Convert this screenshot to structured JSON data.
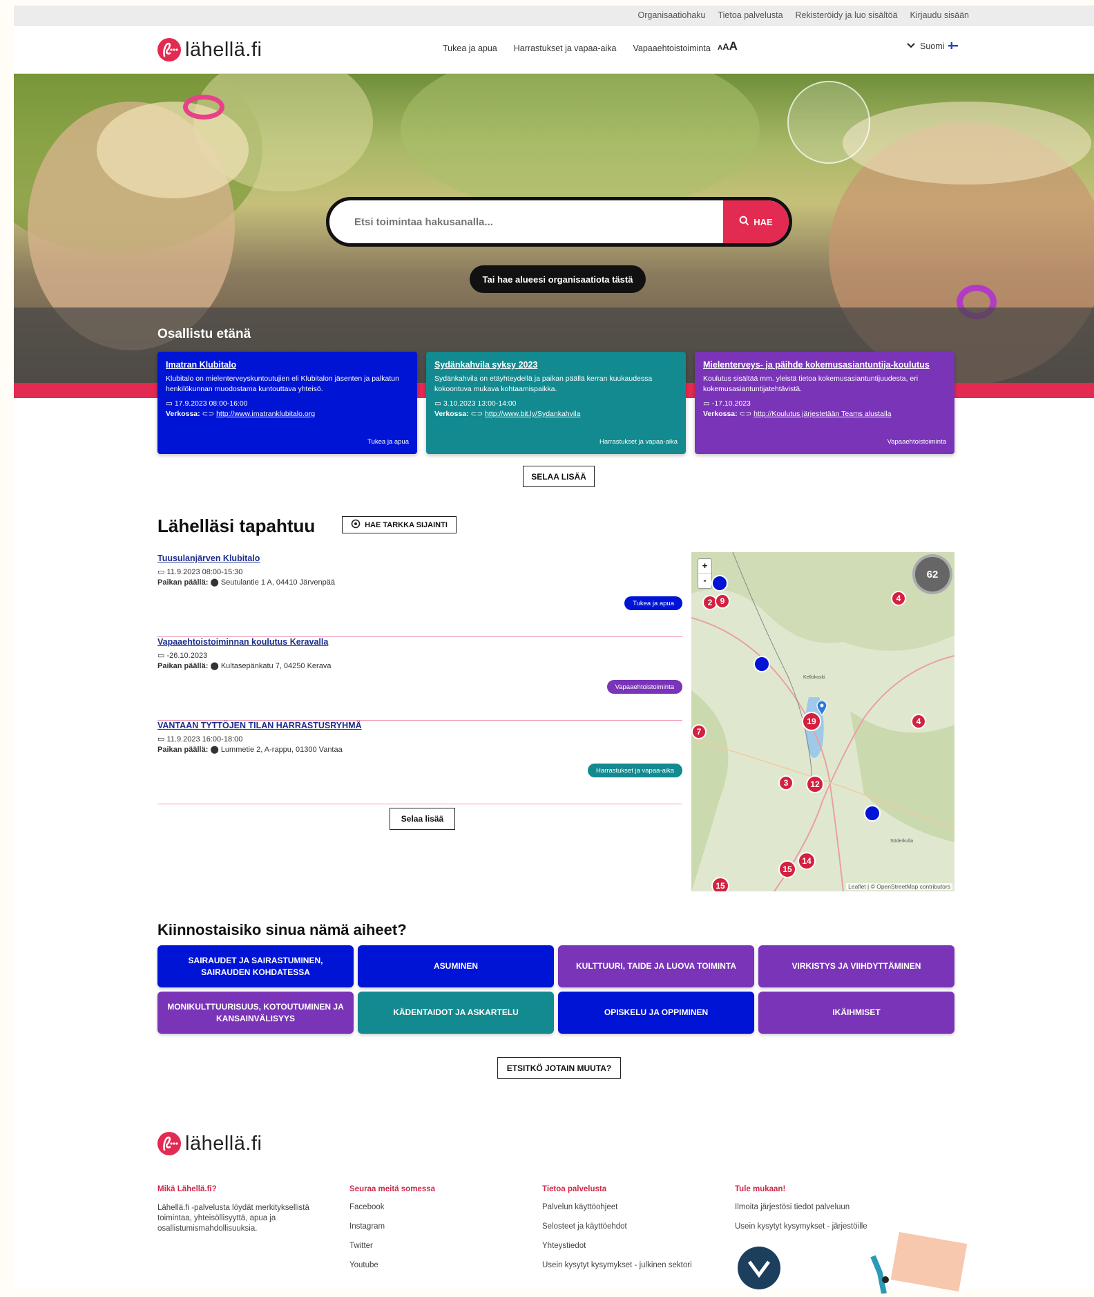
{
  "topbar": {
    "links": [
      "Organisaatiohaku",
      "Tietoa palvelusta",
      "Rekisteröidy ja luo sisältöä",
      "Kirjaudu sisään"
    ]
  },
  "header": {
    "logo_text": "lähellä.fi",
    "nav": [
      "Tukea ja apua",
      "Harrastukset ja vapaa-aika",
      "Vapaaehtoistoiminta"
    ],
    "font_size_label": "AAA",
    "language": "Suomi"
  },
  "hero": {
    "search_placeholder": "Etsi toimintaa hakusanalla...",
    "search_button": "HAE",
    "org_button": "Tai hae alueesi organisaatiota tästä"
  },
  "remote": {
    "title": "Osallistu etänä",
    "cards": [
      {
        "title": "Imatran Klubitalo",
        "desc": "Klubitalo on mielenterveyskuntoutujien eli Klubitalon jäsenten ja palkatun henkilökunnan muodostama kuntouttava yhteisö.",
        "date": "17.9.2023 08:00-16:00",
        "online_label": "Verkossa:",
        "link": "http://www.imatranklubitalo.org",
        "tag": "Tukea ja apua",
        "color": "#0014d6"
      },
      {
        "title": "Sydänkahvila syksy 2023",
        "desc": "Sydänkahvila on etäyhteydellä ja paikan päällä kerran kuukaudessa kokoontuva mukava kohtaamispaikka.",
        "date": "3.10.2023 13:00-14:00",
        "online_label": "Verkossa:",
        "link": "http://www.bit.ly/Sydankahvila",
        "tag": "Harrastukset ja vapaa-aika",
        "color": "#128a90"
      },
      {
        "title": "Mielenterveys- ja päihde kokemusasiantuntija-koulutus",
        "desc": "Koulutus sisältää mm. yleistä tietoa kokemusasiantuntijuudesta, eri kokemusasiantuntijatehtävistä.",
        "date": "-17.10.2023",
        "online_label": "Verkossa:",
        "link": "http://Koulutus järjestetään Teams alustalla",
        "tag": "Vapaaehtoistoiminta",
        "color": "#7a34b8"
      }
    ],
    "more_button": "SELAA LISÄÄ"
  },
  "nearby": {
    "title": "Lähelläsi tapahtuu",
    "location_button": "HAE TARKKA SIJAINTI",
    "onsite_label": "Paikan päällä:",
    "events": [
      {
        "title": "Tuusulanjärven Klubitalo",
        "date": "11.9.2023 08:00-15:30",
        "address": "Seutulantie 1 A, 04410 Järvenpää",
        "tag": "Tukea ja apua",
        "color": "#0014d6"
      },
      {
        "title": "Vapaaehtoistoiminnan koulutus Keravalla",
        "date": "-26.10.2023",
        "address": "Kultasepänkatu 7, 04250 Kerava",
        "tag": "Vapaaehtoistoiminta",
        "color": "#7a34b8"
      },
      {
        "title": "VANTAAN TYTTÖJEN TILAN HARRASTUSRYHMÄ",
        "date": "11.9.2023 16:00-18:00",
        "address": "Lummetie 2, A-rappu, 01300 Vantaa",
        "tag": "Harrastukset ja vapaa-aika",
        "color": "#128a90"
      }
    ],
    "more_button": "Selaa lisää",
    "map": {
      "zoom_in": "+",
      "zoom_out": "-",
      "total_count": "62",
      "clusters": [
        "2",
        "9",
        "4",
        "7",
        "19",
        "4",
        "3",
        "12",
        "14",
        "15",
        "15"
      ],
      "place_labels": [
        "Kellokoski",
        "Söderkulla"
      ],
      "attribution": "Leaflet | © OpenStreetMap contributors"
    }
  },
  "topics": {
    "title": "Kiinnostaisiko sinua nämä aiheet?",
    "items": [
      {
        "label": "SAIRAUDET JA SAIRASTUMINEN, SAIRAUDEN KOHDATESSA",
        "color": "#0014d6"
      },
      {
        "label": "ASUMINEN",
        "color": "#0014d6"
      },
      {
        "label": "KULTTUURI, TAIDE JA LUOVA TOIMINTA",
        "color": "#7a34b8"
      },
      {
        "label": "VIRKISTYS JA VIIHDYTTÄMINEN",
        "color": "#7a34b8"
      },
      {
        "label": "MONIKULTTUURISUUS, KOTOUTUMINEN JA KANSAINVÄLISYYS",
        "color": "#7a34b8"
      },
      {
        "label": "KÄDENTAIDOT JA ASKARTELU",
        "color": "#128a90"
      },
      {
        "label": "OPISKELU JA OPPIMINEN",
        "color": "#0014d6"
      },
      {
        "label": "IKÄIHMISET",
        "color": "#7a34b8"
      }
    ],
    "more_button": "ETSITKÖ JOTAIN MUUTA?"
  },
  "footer": {
    "logo_text": "lähellä.fi",
    "col1": {
      "title": "Mikä Lähellä.fi?",
      "text": "Lähellä.fi -palvelusta löydät merkityksellistä toimintaa, yhteisöllisyyttä, apua ja osallistumismahdollisuuksia."
    },
    "col2": {
      "title": "Seuraa meitä somessa",
      "links": [
        "Facebook",
        "Instagram",
        "Twitter",
        "Youtube"
      ]
    },
    "col3": {
      "title": "Tietoa palvelusta",
      "links": [
        "Palvelun käyttöohjeet",
        "Selosteet ja käyttöehdot",
        "Yhteystiedot",
        "Usein kysytyt kysymykset - julkinen sektori"
      ]
    },
    "col4": {
      "title": "Tule mukaan!",
      "links": [
        "Ilmoita järjestösi tiedot palveluun",
        "Usein kysytyt kysymykset - järjestöille"
      ]
    }
  }
}
